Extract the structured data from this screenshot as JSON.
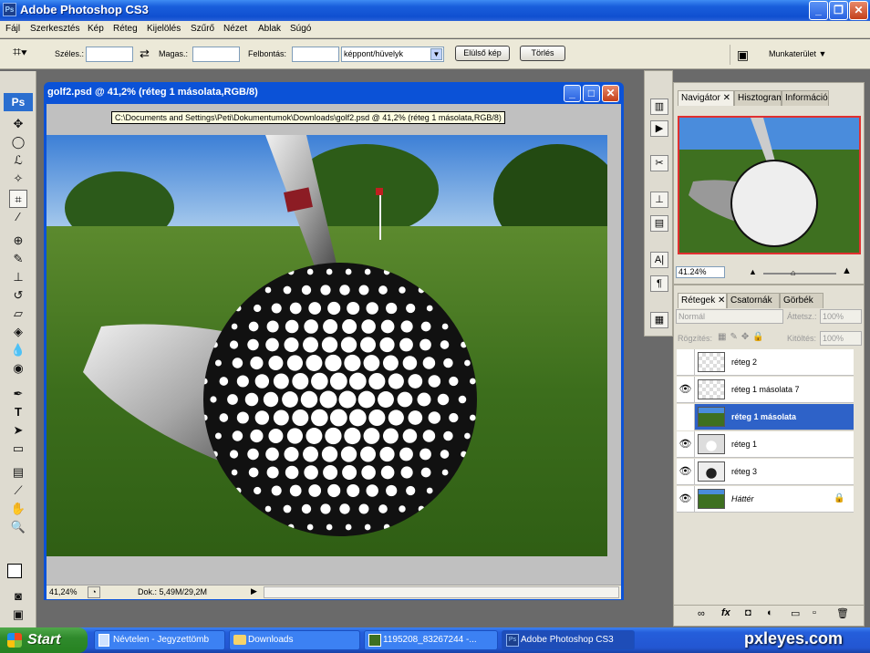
{
  "window": {
    "title": "Adobe Photoshop CS3",
    "app_icon": "Ps"
  },
  "menu": [
    "Fájl",
    "Szerkesztés",
    "Kép",
    "Réteg",
    "Kijelölés",
    "Szűrő",
    "Nézet",
    "Ablak",
    "Súgó"
  ],
  "options": {
    "width_label": "Széles.:",
    "height_label": "Magas.:",
    "resolution_label": "Felbontás:",
    "unit_value": "képpont/hüvelyk",
    "front_image_button": "Elülső kép",
    "clear_button": "Törlés",
    "workspace_label": "Munkaterület ▼"
  },
  "document": {
    "title": "golf2.psd @ 41,2% (réteg 1 másolata,RGB/8)",
    "tooltip": "C:\\Documents and Settings\\Peti\\Dokumentumok\\Downloads\\golf2.psd @ 41,2% (réteg 1 másolata,RGB/8)",
    "zoom": "41,24%",
    "doc_size": "Dok.: 5,49M/29,2M"
  },
  "navigator": {
    "tabs": [
      "Navigátor",
      "Hisztogram",
      "Információ"
    ],
    "zoom": "41.24%"
  },
  "layers_panel": {
    "tabs": [
      "Rétegek",
      "Csatornák",
      "Görbék"
    ],
    "blend_mode": "Normál",
    "opacity_label": "Áttetsz.:",
    "opacity_value": "100%",
    "lock_label": "Rögzítés:",
    "fill_label": "Kitöltés:",
    "fill_value": "100%",
    "layers": [
      {
        "name": "réteg 2",
        "visible": false,
        "selected": false
      },
      {
        "name": "réteg 1 másolata 7",
        "visible": true,
        "selected": false
      },
      {
        "name": "réteg 1 másolata",
        "visible": false,
        "selected": true
      },
      {
        "name": "réteg 1",
        "visible": true,
        "selected": false
      },
      {
        "name": "réteg 3",
        "visible": true,
        "selected": false
      },
      {
        "name": "Háttér",
        "visible": true,
        "selected": false
      }
    ]
  },
  "taskbar": {
    "start_label": "Start",
    "items": [
      "Névtelen - Jegyzettömb",
      "Downloads",
      "1195208_83267244 -...",
      "Adobe Photoshop CS3"
    ]
  },
  "watermark": "pxleyes.com",
  "colors": {
    "accent": "#0b52d7",
    "selection": "#2e62c8",
    "taskbar": "#245edb",
    "start": "#2f8a2c"
  }
}
